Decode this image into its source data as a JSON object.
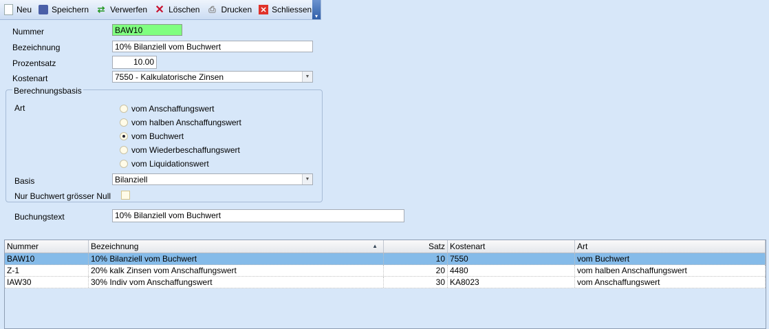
{
  "toolbar": {
    "new": "Neu",
    "save": "Speichern",
    "discard": "Verwerfen",
    "delete": "Löschen",
    "print": "Drucken",
    "close": "Schliessen"
  },
  "form": {
    "nummer_label": "Nummer",
    "nummer": "BAW10",
    "bezeichnung_label": "Bezeichnung",
    "bezeichnung": "10% Bilanziell vom Buchwert",
    "prozentsatz_label": "Prozentsatz",
    "prozentsatz": "10.00",
    "kostenart_label": "Kostenart",
    "kostenart": "7550 - Kalkulatorische Zinsen",
    "group_title": "Berechnungsbasis",
    "art_label": "Art",
    "art_options": [
      "vom Anschaffungswert",
      "vom halben Anschaffungswert",
      "vom Buchwert",
      "vom Wiederbeschaffungswert",
      "vom Liquidationswert"
    ],
    "art_selected": 2,
    "basis_label": "Basis",
    "basis": "Bilanziell",
    "nur_buchwert_label": "Nur Buchwert grösser Null",
    "nur_buchwert_checked": false,
    "buchungstext_label": "Buchungstext",
    "buchungstext": "10% Bilanziell vom Buchwert"
  },
  "grid": {
    "columns": [
      "Nummer",
      "Bezeichnung",
      "Satz",
      "Kostenart",
      "Art"
    ],
    "sort_indicator": "▲",
    "rows": [
      [
        "BAW10",
        "10% Bilanziell vom Buchwert",
        "10",
        "7550",
        "vom Buchwert"
      ],
      [
        "Z-1",
        "20% kalk Zinsen vom Anschaffungswert",
        "20",
        "4480",
        "vom halben Anschaffungswert"
      ],
      [
        "IAW30",
        "30% Indiv vom Anschaffungswert",
        "30",
        "KA8023",
        "vom Anschaffungswert"
      ]
    ],
    "selected_row": 0
  },
  "colors": {
    "nummer_bg": "#80ff80",
    "selected_row": "#85bbe9",
    "background": "#d7e7f9"
  }
}
